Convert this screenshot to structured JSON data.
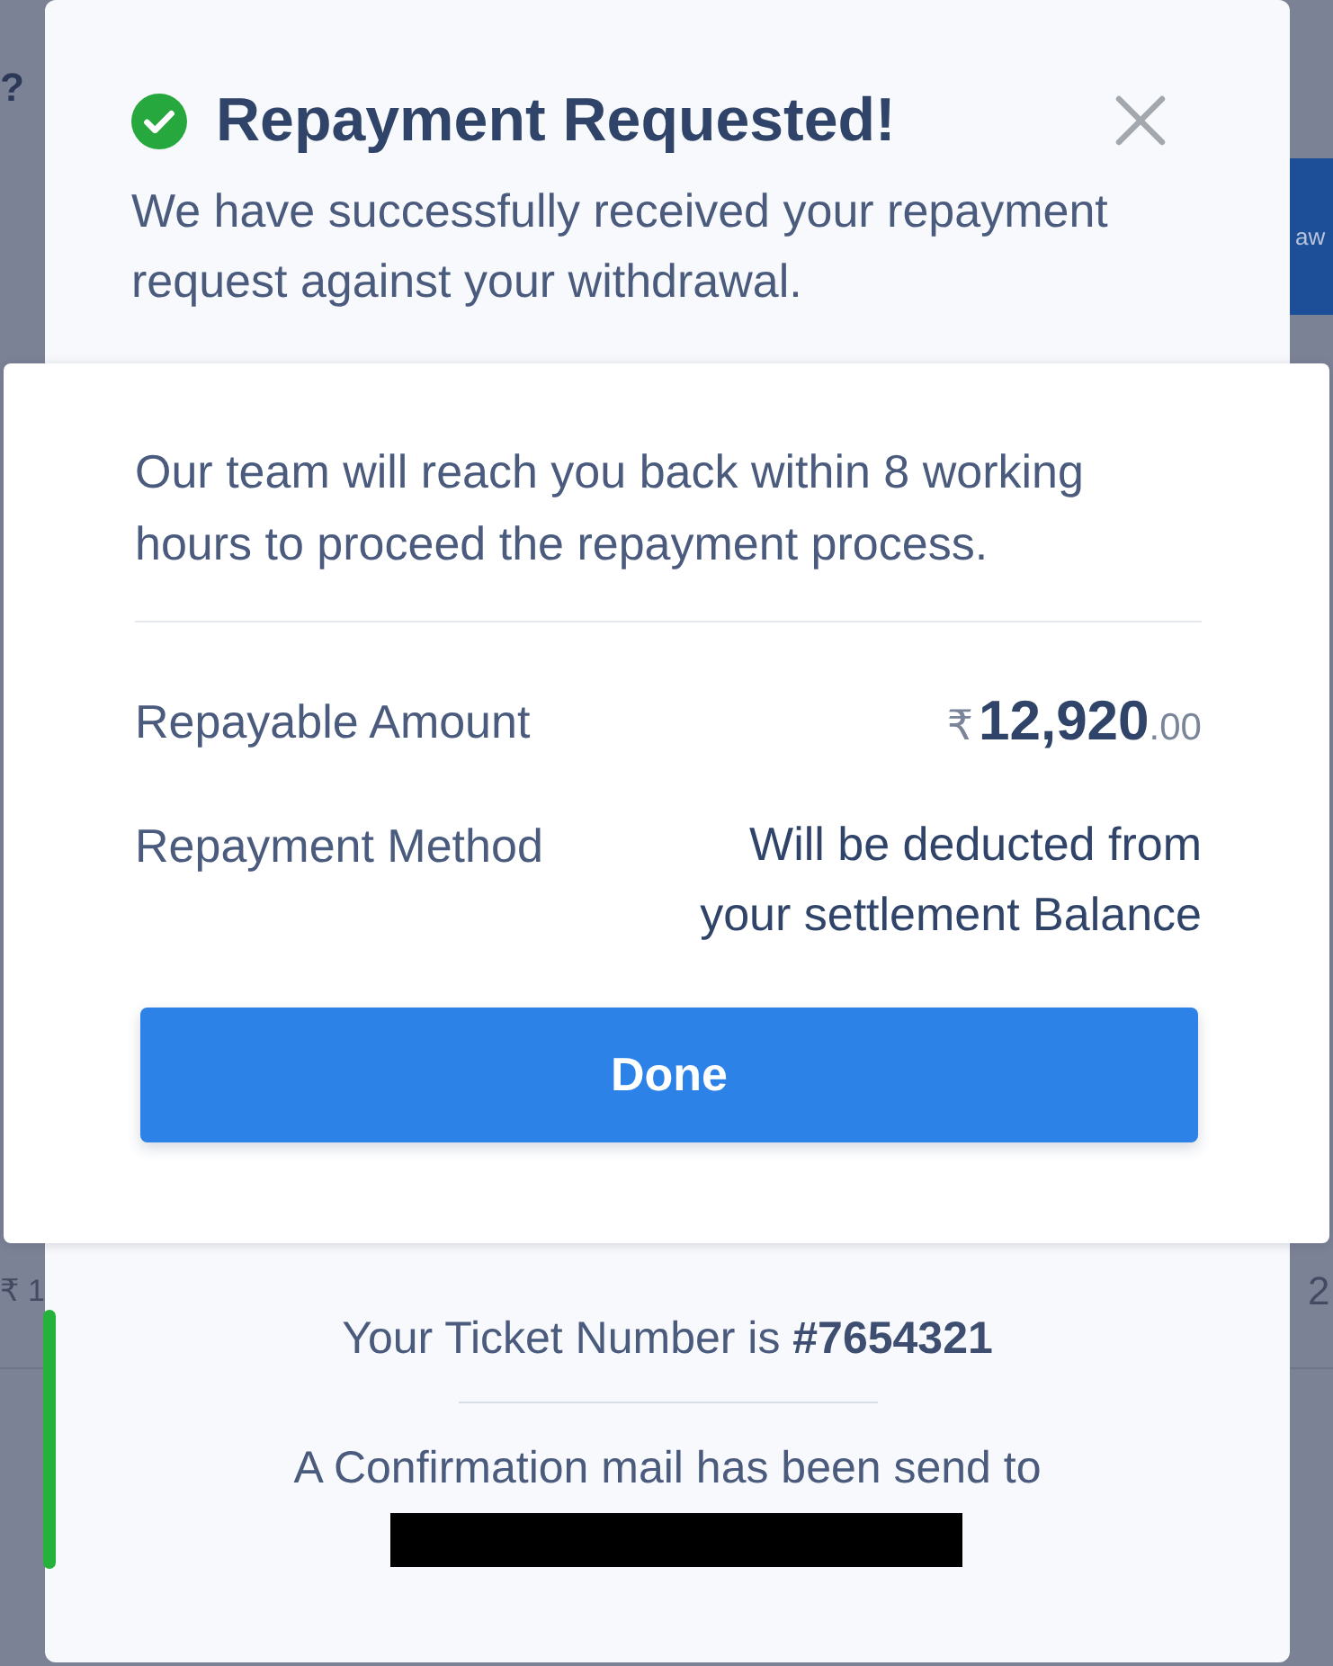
{
  "background": {
    "corner_text": "?",
    "button_label": "aw",
    "row_left_text": "₹ 1",
    "row_right_text": "2"
  },
  "modal": {
    "title": "Repayment Requested!",
    "subtitle": "We have successfully received your repayment request against your withdrawal.",
    "card": {
      "message": "Our team will reach you back within 8 working hours to proceed the repayment process.",
      "details": [
        {
          "kind": "amount",
          "label": "Repayable Amount",
          "currency": "₹",
          "whole": "12,920",
          "fraction": ".00"
        },
        {
          "kind": "text",
          "label": "Repayment Method",
          "value": "Will be deducted from your settlement Balance"
        }
      ],
      "button": "Done"
    },
    "ticket": "Your Ticket Number is **#7654321**",
    "confirmation": "A Confirmation mail has been send to"
  }
}
